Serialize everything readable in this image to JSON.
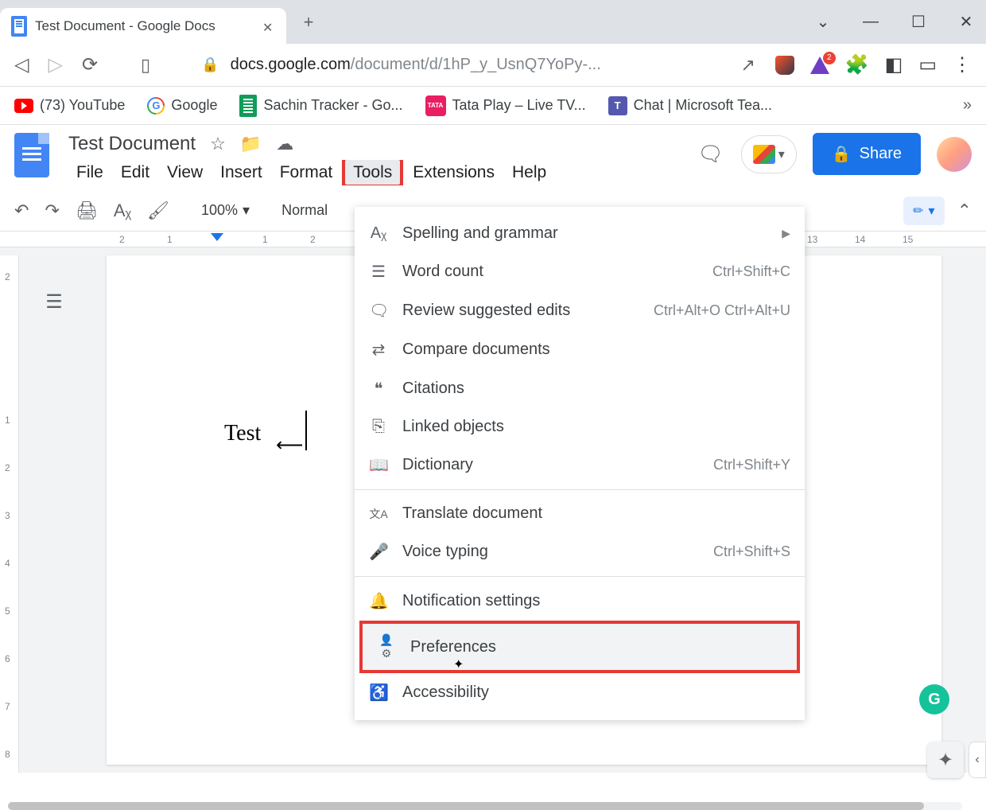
{
  "browser": {
    "tab_title": "Test Document - Google Docs",
    "url_host": "docs.google.com",
    "url_path": "/document/d/1hP_y_UsnQ7YoPy-...",
    "delta_badge": "2",
    "win_dropdown": "⌄",
    "win_min": "—",
    "win_max": "☐",
    "win_close": "✕"
  },
  "bookmarks": [
    {
      "label": "(73) YouTube"
    },
    {
      "label": "Google"
    },
    {
      "label": "Sachin Tracker - Go..."
    },
    {
      "label": "Tata Play – Live TV..."
    },
    {
      "label": "Chat | Microsoft Tea..."
    }
  ],
  "docs": {
    "title": "Test Document",
    "share_label": "Share",
    "menu": [
      "File",
      "Edit",
      "View",
      "Insert",
      "Format",
      "Tools",
      "Extensions",
      "Help"
    ],
    "active_menu": "Tools",
    "zoom": "100%",
    "style": "Normal",
    "page_text": "Test"
  },
  "tools_menu": [
    {
      "icon": "Aᵪ",
      "label": "Spelling and grammar",
      "shortcut": "",
      "submenu": true
    },
    {
      "icon": "☰",
      "label": "Word count",
      "shortcut": "Ctrl+Shift+C"
    },
    {
      "icon": "🗨",
      "label": "Review suggested edits",
      "shortcut": "Ctrl+Alt+O Ctrl+Alt+U"
    },
    {
      "icon": "⇄",
      "label": "Compare documents",
      "shortcut": ""
    },
    {
      "icon": "❝",
      "label": "Citations",
      "shortcut": ""
    },
    {
      "icon": "⎘",
      "label": "Linked objects",
      "shortcut": ""
    },
    {
      "icon": "📖",
      "label": "Dictionary",
      "shortcut": "Ctrl+Shift+Y"
    },
    {
      "sep": true
    },
    {
      "icon": "文A",
      "label": "Translate document",
      "shortcut": ""
    },
    {
      "icon": "🎤",
      "label": "Voice typing",
      "shortcut": "Ctrl+Shift+S"
    },
    {
      "sep": true
    },
    {
      "icon": "🔔",
      "label": "Notification settings",
      "shortcut": ""
    },
    {
      "icon": "👤⚙",
      "label": "Preferences",
      "shortcut": "",
      "highlight": true,
      "hover": true
    },
    {
      "icon": "♿",
      "label": "Accessibility",
      "shortcut": ""
    }
  ],
  "ruler_h": [
    "2",
    "1",
    "",
    "1",
    "2",
    "13",
    "14",
    "15"
  ],
  "ruler_v": [
    "2",
    "1",
    "2",
    "3",
    "4",
    "5",
    "6",
    "7",
    "8"
  ]
}
